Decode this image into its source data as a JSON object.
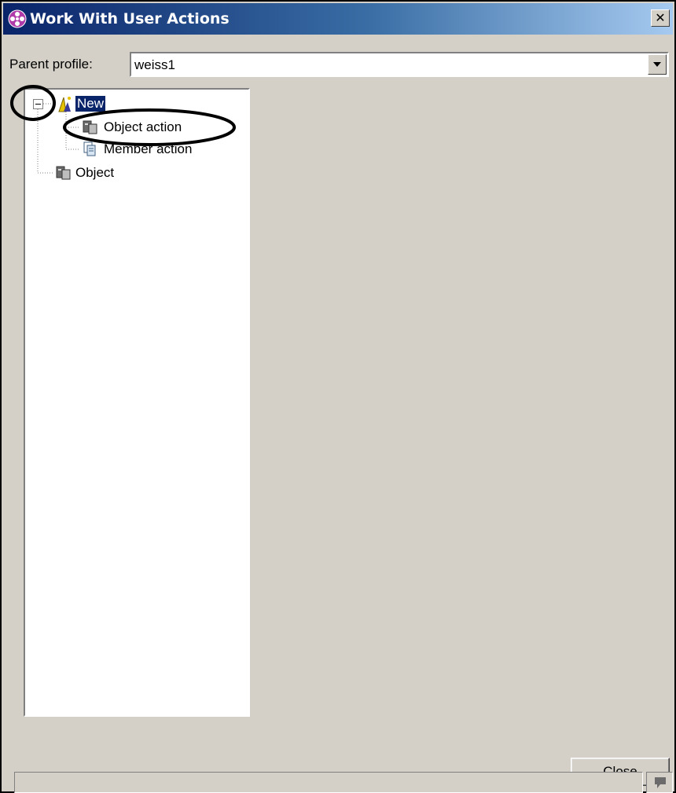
{
  "window": {
    "title": "Work With User Actions",
    "close_glyph": "✕"
  },
  "profile": {
    "label": "Parent profile:",
    "value": "weiss1"
  },
  "tree": {
    "nodes": [
      {
        "label": "New",
        "icon": "new-wizard-icon",
        "expanded": true,
        "selected": true
      },
      {
        "label": "Object action",
        "icon": "object-action-icon"
      },
      {
        "label": "Member action",
        "icon": "member-action-icon"
      },
      {
        "label": "Object",
        "icon": "object-icon"
      }
    ]
  },
  "buttons": {
    "close_label": "lose",
    "close_mnemonic": "C"
  },
  "colors": {
    "title_start": "#0a246a",
    "title_end": "#a6caf0",
    "dialog_bg": "#d4d0c8",
    "annotation": "#000000"
  }
}
